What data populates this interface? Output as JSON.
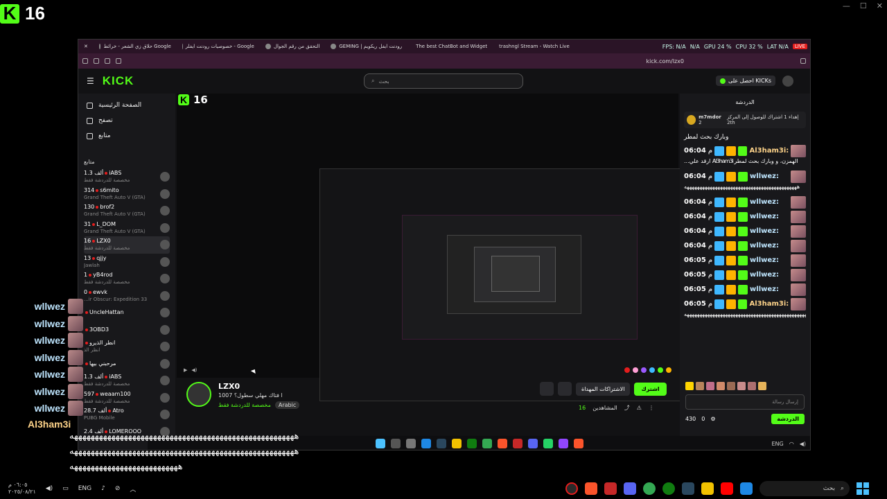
{
  "overlay": {
    "logo_letter": "K",
    "viewer_count": "16",
    "chat": [
      {
        "user": "wllwez"
      },
      {
        "user": "wllwez"
      },
      {
        "user": "wllwez"
      },
      {
        "user": "wllwez"
      },
      {
        "user": "wllwez"
      },
      {
        "user": "wllwez"
      },
      {
        "user": "wllwez"
      }
    ],
    "last_user": "Al3ham3i",
    "last_msg_1": "ههههههههههههههههههههههههههههههههههههههههههههههههههههههه",
    "last_msg_2": "ههههههههههههههههههههههههههههههههههههههههههههههههههههههه",
    "last_msg_3": "ههههههههههههههههههههههههههه"
  },
  "browser": {
    "tabs": [
      "حلاق زي الشعر - خرائط Google",
      "خصوصيات رودنت ايفلر - Google",
      "التحقق من رقم الجوال",
      "GEMING | رودنت ايفل ريكويم",
      "The best ChatBot and Widget",
      "trashngl Stream - Watch Live"
    ],
    "perf": [
      "FPS: N/A",
      "N/A",
      "GPU 24 %",
      "CPU 32 %",
      "LAT N/A"
    ],
    "live_label": "LIVE",
    "url": "kick.com/lzx0"
  },
  "kick": {
    "wordmark": "KICK",
    "search_placeholder": "بحث",
    "get_kicks": "احصل على KICKs",
    "nav": [
      "الصفحة الرئيسية",
      "تصفح",
      "متابع"
    ],
    "following_title": "متابع",
    "channels": [
      {
        "viewers": "1.3 ألف",
        "name": "iABS",
        "cat": "مخصصة للدردشة فقط"
      },
      {
        "viewers": "314",
        "name": "s6mito",
        "cat": "Grand Theft Auto V (GTA)"
      },
      {
        "viewers": "130",
        "name": "brof2",
        "cat": "Grand Theft Auto V (GTA)"
      },
      {
        "viewers": "31",
        "name": "L_DOM",
        "cat": "Grand Theft Auto V (GTA)"
      },
      {
        "viewers": "16",
        "name": "LZX0",
        "cat": "مخصصة للدردشة فقط"
      },
      {
        "viewers": "13",
        "name": "qjjy",
        "cat": "Jawlah"
      },
      {
        "viewers": "1",
        "name": "yB4rod",
        "cat": "مخصصة للدردشة فقط"
      },
      {
        "viewers": "0",
        "name": "ewvk",
        "cat": "...ir Obscur: Expedition 33"
      },
      {
        "viewers": "",
        "name": "UncleHattan",
        "cat": ""
      },
      {
        "viewers": "",
        "name": "3OBD3",
        "cat": ""
      },
      {
        "viewers": "",
        "name": "انطر الذيرو",
        "cat": "انظر الذ"
      },
      {
        "viewers": "",
        "name": "مرحبني بيها",
        "cat": ""
      },
      {
        "viewers": "1.3 ألف",
        "name": "iABS",
        "cat": "مخصصة للدردشة فقط"
      },
      {
        "viewers": "597",
        "name": "weaam100",
        "cat": "مخصصة للدردشة فقط"
      },
      {
        "viewers": "28.7 ألف",
        "name": "Atro",
        "cat": "PUBG Mobile"
      },
      {
        "viewers": "2.4 ألف",
        "name": "LOMEROOO",
        "cat": ""
      }
    ],
    "video_viewer": "16",
    "streamer": {
      "name": "LZX0",
      "title": "1007 ا فتاك مهلي سطول؟",
      "category": "مخصصة للدردشة فقط",
      "language": "Arabic",
      "live": "LIVE"
    },
    "actions": {
      "subscribe": "اشترك",
      "gift": "الاشتراكات المهداة",
      "viewers_label": "المشاهدين",
      "viewers_count": "16"
    },
    "chat": {
      "title": "الدردشة",
      "pinned_user": "m7mdor",
      "pinned_sub": "2",
      "pinned_text": "إهداء 1 اشتراك للوصول إلى المركز 2th",
      "header_msg": "وبارك بحث لمطر",
      "messages": [
        {
          "time": "06:04",
          "ampm": "م",
          "user": "Al3ham3i:",
          "msg": "...ارقد علي Al3ham3i الهمزن، و وبارك بحث لمطر",
          "alt": true
        },
        {
          "time": "06:04",
          "ampm": "م",
          "user": "wllwez:",
          "msg": "ههههههههههههههههههههههههههههههههههههههههههههه",
          "alt": false
        },
        {
          "time": "06:04",
          "ampm": "م",
          "user": "wllwez:",
          "msg": "",
          "alt": false
        },
        {
          "time": "06:04",
          "ampm": "م",
          "user": "wllwez:",
          "msg": "",
          "alt": false
        },
        {
          "time": "06:04",
          "ampm": "م",
          "user": "wllwez:",
          "msg": "",
          "alt": false
        },
        {
          "time": "06:04",
          "ampm": "م",
          "user": "wllwez:",
          "msg": "",
          "alt": false
        },
        {
          "time": "06:05",
          "ampm": "م",
          "user": "wllwez:",
          "msg": "",
          "alt": false
        },
        {
          "time": "06:05",
          "ampm": "م",
          "user": "wllwez:",
          "msg": "",
          "alt": false
        },
        {
          "time": "06:05",
          "ampm": "م",
          "user": "wllwez:",
          "msg": "",
          "alt": false
        },
        {
          "time": "06:05",
          "ampm": "م",
          "user": "Al3ham3i:",
          "msg": "هههههههههههههههههههههههههههههههههههههههههههههههههههههههههههههههههههههههههههههههههههههههههه",
          "alt": true
        }
      ],
      "input_placeholder": "إرسال رسالة",
      "kicks_count": "430",
      "zero": "0",
      "send": "الدردشة"
    }
  },
  "inner_tray": {
    "lang": "ENG"
  },
  "taskbar": {
    "time": "٠٦:٠٥ م",
    "date": "٢٠٢٥/٠٨/٢١",
    "lang": "ENG",
    "search_placeholder": "بحث"
  },
  "colors": {
    "kick_green": "#53fc18",
    "chat_name": "#bfe6ff",
    "alt_name": "#ffd48a"
  }
}
